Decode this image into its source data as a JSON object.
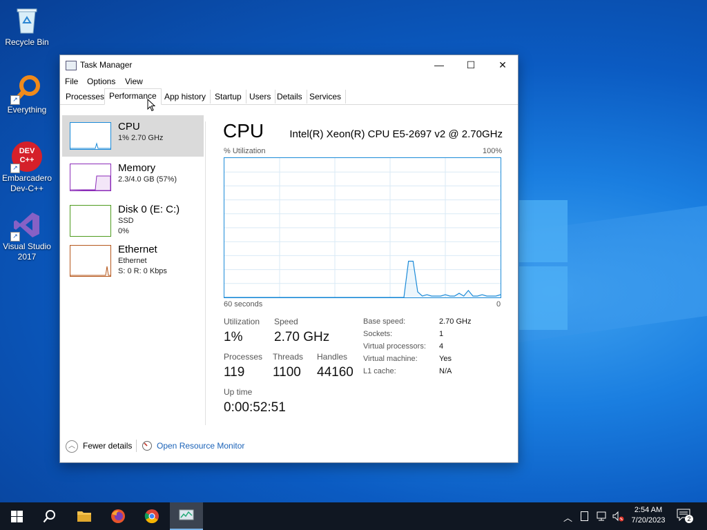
{
  "desktop": {
    "icons": [
      {
        "label": "Recycle Bin",
        "icon": "recycle-bin-icon"
      },
      {
        "label": "Everything",
        "icon": "everything-search-icon"
      },
      {
        "label": "Embarcadero Dev-C++",
        "icon": "devcpp-icon",
        "badge_text": "DEV C++"
      },
      {
        "label": "Visual Studio 2017",
        "icon": "visual-studio-icon"
      }
    ]
  },
  "window": {
    "title": "Task Manager",
    "controls": {
      "minimize": "—",
      "maximize": "☐",
      "close": "✕"
    }
  },
  "menu": [
    "File",
    "Options",
    "View"
  ],
  "tabs": [
    "Processes",
    "Performance",
    "App history",
    "Startup",
    "Users",
    "Details",
    "Services"
  ],
  "active_tab": "Performance",
  "sidebar": [
    {
      "title": "CPU",
      "line1": "1% 2.70 GHz",
      "line2": "",
      "color": "#1a8ad8"
    },
    {
      "title": "Memory",
      "line1": "2.3/4.0 GB (57%)",
      "line2": "",
      "color": "#8b2bb8"
    },
    {
      "title": "Disk 0 (E: C:)",
      "line1": "SSD",
      "line2": "0%",
      "color": "#4d9a1c"
    },
    {
      "title": "Ethernet",
      "line1": "Ethernet",
      "line2": "S: 0 R: 0 Kbps",
      "color": "#b5561a"
    }
  ],
  "detail": {
    "title": "CPU",
    "cpu_name": "Intel(R) Xeon(R) CPU E5-2697 v2 @ 2.70GHz",
    "y_label": "% Utilization",
    "y_max": "100%",
    "x_left": "60 seconds",
    "x_right": "0",
    "stats": {
      "utilization_label": "Utilization",
      "utilization": "1%",
      "speed_label": "Speed",
      "speed": "2.70 GHz",
      "processes_label": "Processes",
      "processes": "119",
      "threads_label": "Threads",
      "threads": "1100",
      "handles_label": "Handles",
      "handles": "44160",
      "uptime_label": "Up time",
      "uptime": "0:00:52:51"
    },
    "specs": [
      {
        "k": "Base speed:",
        "v": "2.70 GHz"
      },
      {
        "k": "Sockets:",
        "v": "1"
      },
      {
        "k": "Virtual processors:",
        "v": "4"
      },
      {
        "k": "Virtual machine:",
        "v": "Yes"
      },
      {
        "k": "L1 cache:",
        "v": "N/A"
      }
    ]
  },
  "footer": {
    "fewer_details": "Fewer details",
    "resource_monitor": "Open Resource Monitor"
  },
  "chart_data": {
    "type": "line",
    "x": [
      60,
      59,
      58,
      57,
      56,
      55,
      54,
      53,
      52,
      51,
      50,
      49,
      48,
      47,
      46,
      45,
      44,
      43,
      42,
      41,
      40,
      39,
      38,
      37,
      36,
      35,
      34,
      33,
      32,
      31,
      30,
      29,
      28,
      27,
      26,
      25,
      24,
      23,
      22,
      21,
      20,
      19,
      18,
      17,
      16,
      15,
      14,
      13,
      12,
      11,
      10,
      9,
      8,
      7,
      6,
      5,
      4,
      3,
      2,
      1,
      0
    ],
    "values": [
      0,
      0,
      0,
      0,
      0,
      0,
      0,
      0,
      0,
      0,
      0,
      0,
      0,
      0,
      0,
      0,
      0,
      0,
      0,
      0,
      0,
      0,
      0,
      0,
      0,
      0,
      0,
      0,
      0,
      0,
      0,
      0,
      0,
      0,
      0,
      0,
      0,
      0,
      0,
      0,
      26,
      26,
      4,
      1,
      2,
      1,
      1,
      1,
      2,
      1,
      1,
      3,
      1,
      5,
      1,
      1,
      2,
      1,
      1,
      1,
      2
    ],
    "xlabel": "60 seconds",
    "ylabel": "% Utilization",
    "ylim": [
      0,
      100
    ],
    "grid": true,
    "color": "#1a8ad8"
  },
  "taskbar": {
    "items": [
      "start-icon",
      "search-icon",
      "file-explorer-icon",
      "firefox-icon",
      "chrome-icon",
      "task-manager-icon"
    ],
    "time": "2:54 AM",
    "date": "7/20/2023",
    "notification_count": "2"
  }
}
